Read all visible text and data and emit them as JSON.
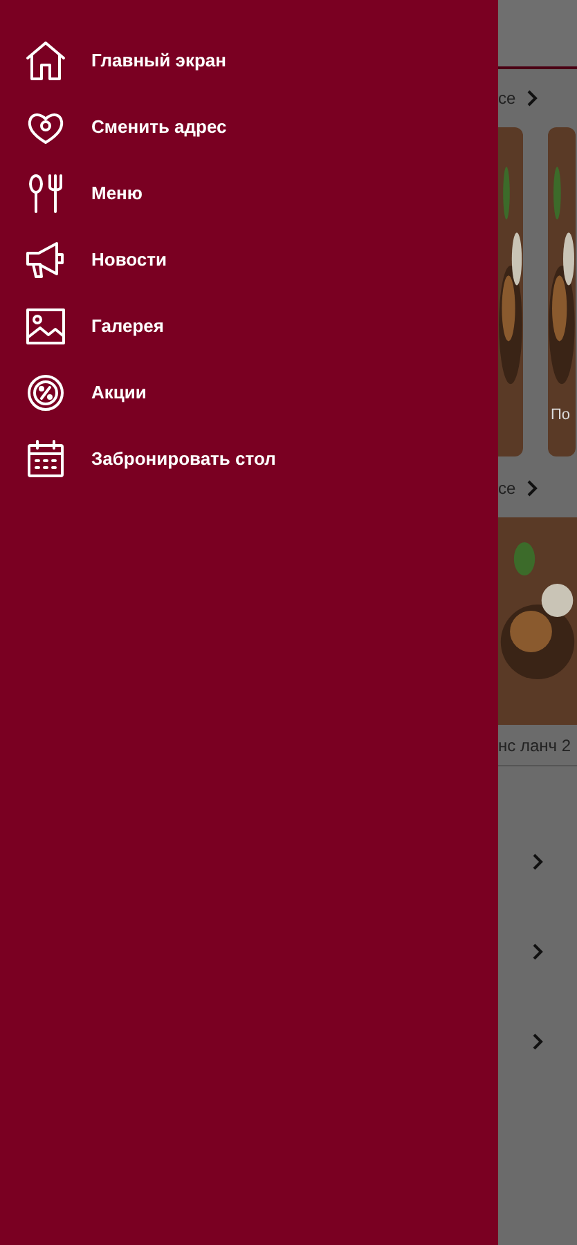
{
  "drawer": {
    "items": [
      {
        "kind": "home",
        "label": "Главный экран"
      },
      {
        "kind": "address",
        "label": "Сменить адрес"
      },
      {
        "kind": "menu",
        "label": "Меню"
      },
      {
        "kind": "news",
        "label": "Новости"
      },
      {
        "kind": "gallery",
        "label": "Галерея"
      },
      {
        "kind": "promo",
        "label": "Акции"
      },
      {
        "kind": "booking",
        "label": "Забронировать стол"
      }
    ]
  },
  "background": {
    "sections": [
      {
        "link": "се",
        "cards": [
          {
            "kind": "picture"
          },
          {
            "kind": "picture",
            "caption": "По"
          }
        ]
      },
      {
        "link": "се",
        "cards": [
          {
            "kind": "picture",
            "caption": "нс ланч 2"
          }
        ]
      }
    ],
    "list_rows": [
      {
        "kind": "chevron"
      },
      {
        "kind": "chevron"
      },
      {
        "kind": "chevron"
      }
    ]
  }
}
